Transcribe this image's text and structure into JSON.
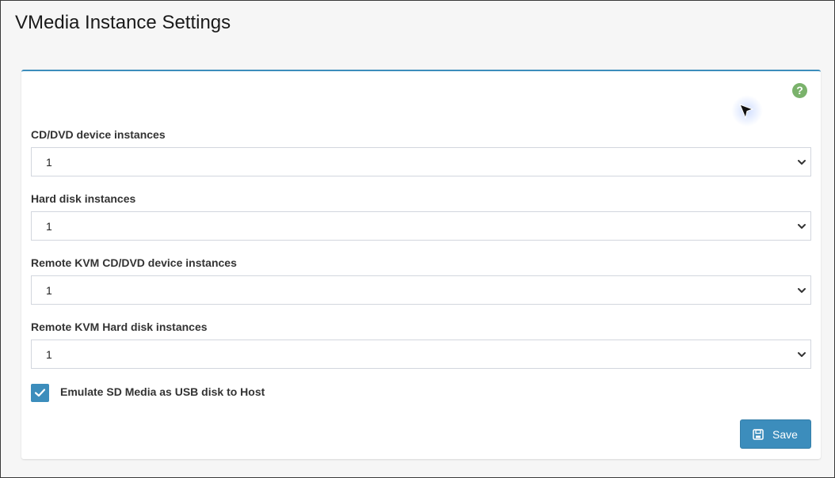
{
  "page": {
    "title": "VMedia Instance Settings"
  },
  "panel": {
    "accent_color": "#3c8dbc",
    "help_icon": "question-circle-icon",
    "help_text": "?"
  },
  "fields": [
    {
      "label": "CD/DVD device instances",
      "value": "1"
    },
    {
      "label": "Hard disk instances",
      "value": "1"
    },
    {
      "label": "Remote KVM CD/DVD device instances",
      "value": "1"
    },
    {
      "label": "Remote KVM Hard disk instances",
      "value": "1"
    }
  ],
  "emulate": {
    "label": "Emulate SD Media as USB disk to Host",
    "checked": true,
    "icon": "checkmark-icon"
  },
  "actions": {
    "save_label": "Save",
    "save_icon": "floppy-disk-icon",
    "button_color": "#3c8dbc"
  }
}
